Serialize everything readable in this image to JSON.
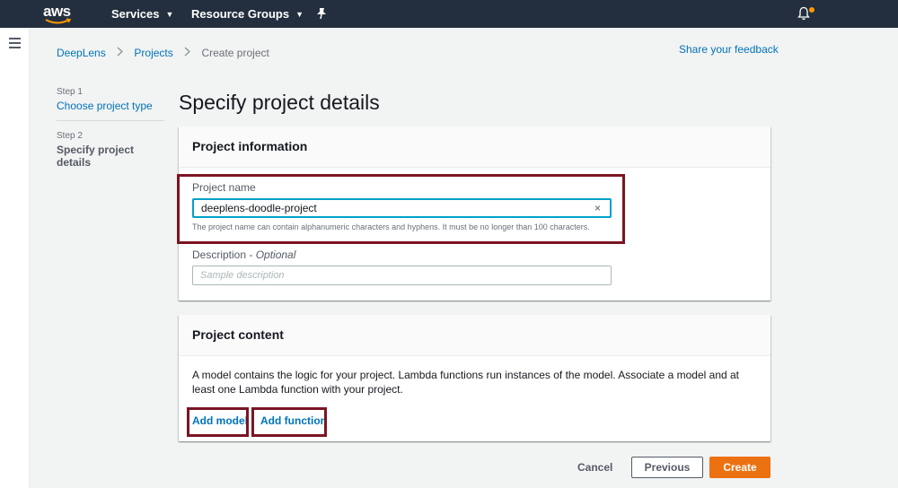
{
  "topnav": {
    "logo_text": "aws",
    "services_label": "Services",
    "resource_groups_label": "Resource Groups",
    "caret_icon": "caret-down-icon",
    "pin_icon": "pin-icon",
    "bell_icon": "bell-icon",
    "notification_color": "#ff9900",
    "background_color": "#232f3e"
  },
  "breadcrumb": {
    "items": [
      "DeepLens",
      "Projects",
      "Create project"
    ]
  },
  "feedback_link": "Share your feedback",
  "steps": [
    {
      "number": "Step 1",
      "title": "Choose project type"
    },
    {
      "number": "Step 2",
      "title": "Specify project details"
    }
  ],
  "page_title": "Specify project details",
  "project_information": {
    "header": "Project information",
    "name_label": "Project name",
    "name_value": "deeplens-doodle-project",
    "clear_symbol": "×",
    "name_hint": "The project name can contain alphanumeric characters and hyphens. It must be no longer than 100 characters.",
    "description_label": "Description - ",
    "description_optional": "Optional",
    "description_placeholder": "Sample description"
  },
  "project_content": {
    "header": "Project content",
    "text": "A model contains the logic for your project. Lambda functions run instances of the model. Associate a model and at least one Lambda function with your project.",
    "add_model": "Add model",
    "add_function": "Add function"
  },
  "footer": {
    "cancel": "Cancel",
    "previous": "Previous",
    "create": "Create"
  },
  "colors": {
    "link": "#0073bb",
    "primary_button": "#ec7211",
    "highlight_border": "#7a1523",
    "focus_border": "#00a1c9"
  }
}
